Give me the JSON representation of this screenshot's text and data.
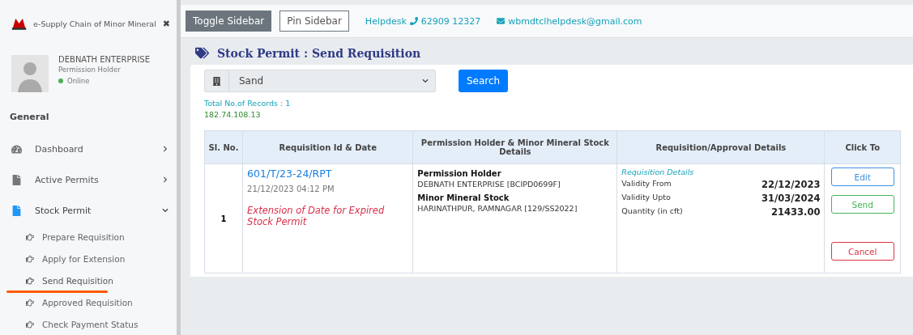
{
  "sidebar": {
    "brand": "e-Supply Chain of Minor Mineral",
    "close": "✖",
    "user": {
      "name": "DEBNATH ENTERPRISE",
      "role": "Permission Holder",
      "status": "Online"
    },
    "section": "General",
    "items": [
      {
        "label": "Dashboard",
        "kind": "gauge",
        "expanded": false,
        "selected": false
      },
      {
        "label": "Active Permits",
        "kind": "file",
        "expanded": false,
        "selected": false
      },
      {
        "label": "Stock Permit",
        "kind": "file",
        "expanded": true,
        "selected": true,
        "children": [
          {
            "label": "Prepare Requisition",
            "selected": false
          },
          {
            "label": "Apply for Extension",
            "selected": false
          },
          {
            "label": "Send Requisition",
            "selected": true
          },
          {
            "label": "Approved Requisition",
            "selected": false
          },
          {
            "label": "Check Payment Status",
            "selected": false
          }
        ]
      }
    ]
  },
  "topbar": {
    "buttons": [
      {
        "label": "Toggle Sidebar",
        "kind": "dark"
      },
      {
        "label": "Pin Sidebar",
        "kind": "outline"
      }
    ],
    "helpdesk": "Helpdesk",
    "phone": "62909 12327",
    "email": "wbmdtclhelpdesk@gmail.com"
  },
  "page": {
    "title": "Stock Permit : Send Requisition",
    "select": {
      "value": "Sand"
    },
    "search": "Search",
    "records": "Total No.of Records : 1",
    "ip": "182.74.108.13"
  },
  "table": {
    "columns": [
      "Sl. No.",
      "Requisition Id & Date",
      "Permission Holder & Minor Mineral Stock Details",
      "Requisition/Approval Details",
      "Click To"
    ],
    "rows": [
      {
        "sl": "1",
        "id": "601/T/23-24/RPT",
        "date": "21/12/2023 04:12 PM",
        "note": "Extension of Date for Expired Stock Permit",
        "holder_label": "Permission Holder",
        "holder": "DEBNATH ENTERPRISE [BCIPD0699F]",
        "stock_label": "Minor Mineral Stock",
        "stock": "HARINATHPUR, RAMNAGAR [129/SS2022]",
        "details_title": "Requisition Details",
        "details": [
          {
            "label": "Validity From",
            "value": "22/12/2023"
          },
          {
            "label": "Validity Upto",
            "value": "31/03/2024"
          },
          {
            "label": "Quantity (in cft)",
            "value": "21433.00"
          }
        ],
        "actions": [
          {
            "label": "Edit",
            "kind": "edit"
          },
          {
            "label": "Send",
            "kind": "send"
          },
          {
            "label": "Cancel",
            "kind": "cancel"
          }
        ]
      }
    ]
  }
}
